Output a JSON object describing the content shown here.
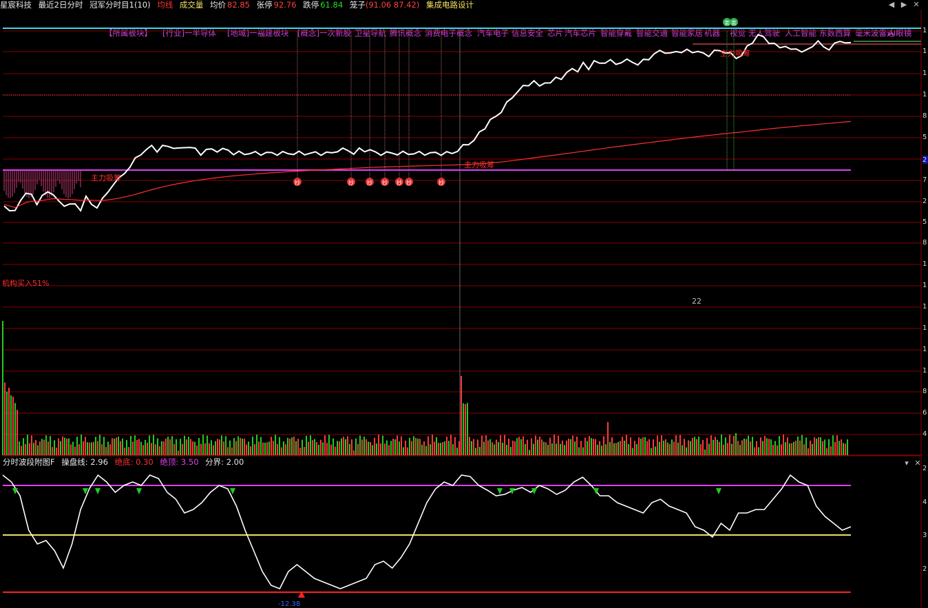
{
  "header": {
    "stock_name": "星宸科技",
    "period": "最近2日分时",
    "indicator": "冠军分时目1(10)",
    "ma_label": "均线",
    "volume_label": "成交量",
    "avg_label": "均价",
    "avg_value": "82.85",
    "limit_up_label": "张停",
    "limit_up_value": "92.76",
    "limit_down_label": "跌停",
    "limit_down_value": "61.84",
    "cage_label": "笼子",
    "cage_value": "(91.06 87.42)",
    "concept": "集成电路设计"
  },
  "tags": [
    "【所属板块】",
    "[行业]一半导体",
    "[地域]一福建板块",
    "[概念]一次新股",
    "卫星导航",
    "腾讯概念",
    "消费电子概念",
    "汽车电子",
    "信息安全",
    "芯片",
    "汽车芯片",
    "智能穿戴",
    "智能交通",
    "智能家居",
    "机器",
    "视觉",
    "无人驾驶",
    "人工智能",
    "东数西算",
    "毫米波雷达",
    "AI眼镜"
  ],
  "annotations": {
    "main_force_1": "主力吸筹",
    "main_force_2": "主力吸筹",
    "main_force_3": "主力吸筹",
    "institution": "机构买入51%",
    "count": "22",
    "buy_marker": "抄",
    "sell_marker": "卖",
    "osc_bottom_value": "-12.38"
  },
  "oscillator": {
    "title": "分时波段附图F",
    "op_label": "操盘线:",
    "op_value": "2.96",
    "bottom_label": "绝底:",
    "bottom_value": "0.30",
    "top_label": "绝顶:",
    "top_value": "3.50",
    "divide_label": "分界:",
    "divide_value": "2.00"
  },
  "right_axis": [
    "1",
    "1",
    "1",
    "1",
    "8",
    "5",
    "2",
    "7",
    "2",
    "5",
    "8",
    "1",
    "1",
    "1",
    "1",
    "1",
    "1",
    "8",
    "6",
    "4",
    "2",
    "4",
    "3",
    "2",
    "1"
  ],
  "colors": {
    "up": "#ff3b3b",
    "down": "#22cc22",
    "price": "#ffffff",
    "avg": "#ff3030",
    "magenta": "#e040f0",
    "cyan": "#40d8e8",
    "yellow": "#f0e060",
    "grid": "#8a0000"
  },
  "chart_data": {
    "type": "line",
    "note_series": "intraday price (px-sampled shape), volume bars, oscillator",
    "price": [
      13,
      12,
      11,
      15,
      17,
      16,
      14,
      16,
      17,
      17,
      14,
      13,
      14,
      13,
      12,
      16,
      13,
      13,
      15,
      17,
      20,
      21,
      23,
      25,
      27,
      29,
      30,
      31,
      30,
      31,
      31,
      31,
      30,
      31,
      31,
      30,
      29,
      30,
      30,
      30,
      30,
      30,
      29,
      29,
      29,
      29,
      29,
      29,
      29,
      29,
      29,
      29,
      29,
      29,
      29,
      29,
      29,
      29,
      29,
      29,
      29,
      30,
      30,
      30,
      29,
      30,
      30,
      30,
      29,
      29,
      29,
      29,
      29,
      29,
      29,
      29,
      29,
      29,
      29,
      29,
      29,
      29,
      29,
      30,
      31,
      32,
      33,
      35,
      37,
      39,
      40,
      42,
      44,
      46,
      48,
      49,
      50,
      51,
      49,
      51,
      50,
      52,
      52,
      53,
      55,
      54,
      56,
      55,
      57,
      56,
      57,
      57,
      56,
      57,
      57,
      57,
      56,
      57,
      58,
      59,
      60,
      60,
      59,
      60,
      60,
      60,
      60,
      60,
      59,
      59,
      60,
      60,
      60,
      59,
      58,
      59,
      61,
      63,
      65,
      64,
      63,
      62,
      61,
      62,
      60,
      61,
      60,
      60,
      62,
      63,
      61,
      61,
      62,
      63,
      63,
      62
    ],
    "volume_note": "volume bars per minute",
    "oscillator_levels": {
      "bottom": 0.3,
      "top": 3.5,
      "divide": 2.0,
      "current": 2.96
    }
  }
}
